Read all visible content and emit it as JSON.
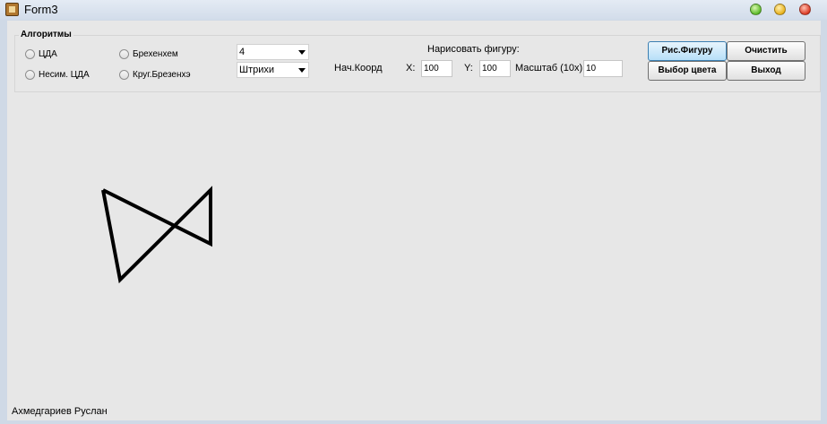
{
  "window": {
    "title": "Form3"
  },
  "algorithms": {
    "group_label": "Алгоритмы",
    "options": [
      "ЦДА",
      "Несим. ЦДА",
      "Брехенхем",
      "Круг.Брезенхэ"
    ]
  },
  "combos": {
    "count_value": "4",
    "style_value": "Штрихи"
  },
  "draw": {
    "header": "Нарисовать фигуру:",
    "start_label": "Нач.Коорд",
    "x_label": "X:",
    "x_value": "100",
    "y_label": "Y:",
    "y_value": "100",
    "scale_label": "Масштаб (10x)",
    "scale_value": "10"
  },
  "buttons": {
    "draw_figure": "Рис.Фигуру",
    "clear": "Очистить",
    "pick_color": "Выбор цвета",
    "exit": "Выход"
  },
  "footer": {
    "author": "Ахмедгариев Руслан"
  },
  "colors": {
    "figure_stroke": "#000000",
    "active_button": "#b7dff8"
  }
}
